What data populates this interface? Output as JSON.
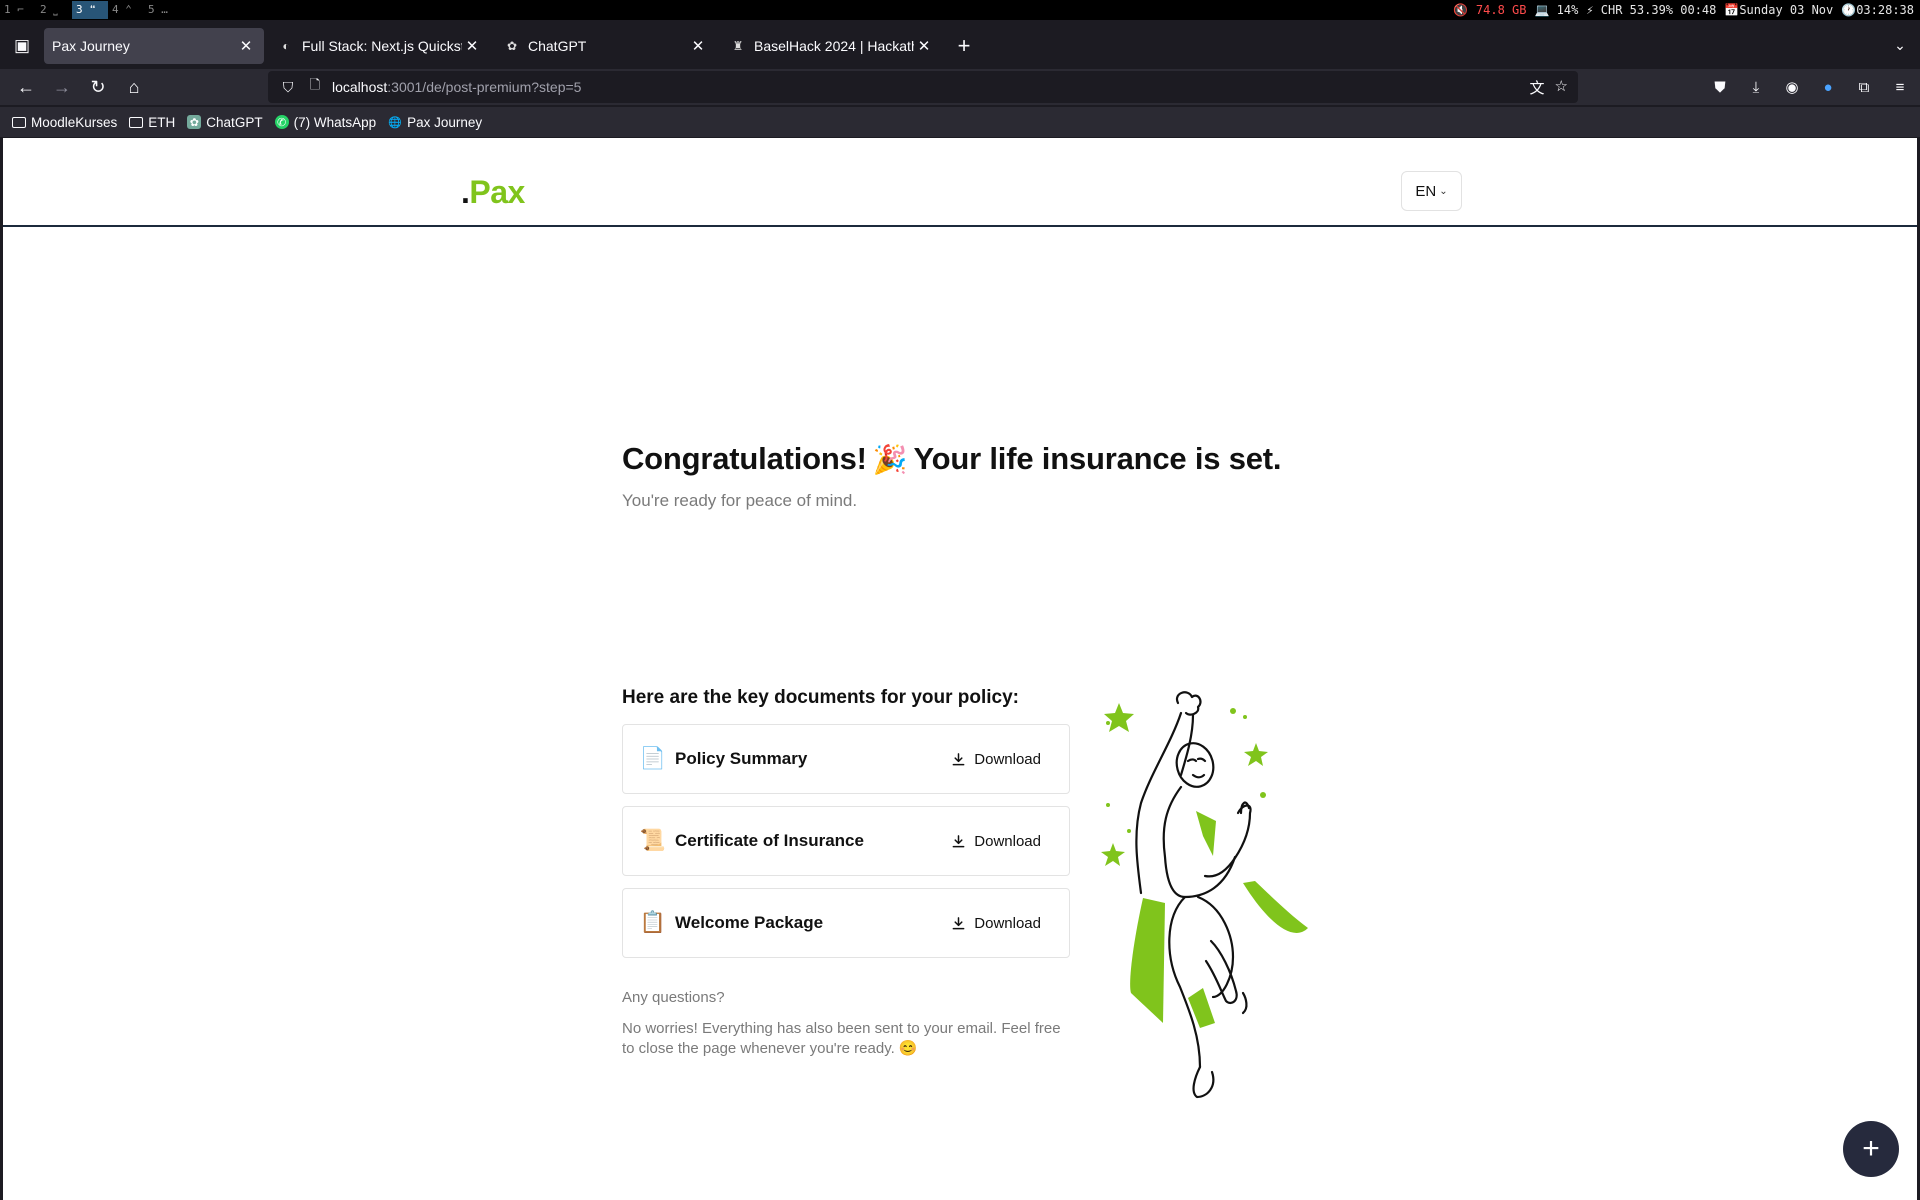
{
  "system": {
    "workspaces": [
      "1 ⌐",
      "2 ⎵",
      "3 ❝",
      "4 ⌃",
      "5 …"
    ],
    "active_workspace": 2,
    "status": [
      "74.8 GB",
      "💻 14%",
      "⚡ CHR 53.39% 00:48",
      "📅Sunday 03 Nov",
      "🕐03:28:38"
    ]
  },
  "browser": {
    "tabs": [
      {
        "title": "Pax Journey",
        "selected": true
      },
      {
        "title": "Full Stack: Next.js Quicksta",
        "selected": false
      },
      {
        "title": "ChatGPT",
        "selected": false
      },
      {
        "title": "BaselHack 2024 | Hackath",
        "selected": false
      }
    ],
    "url_host": "localhost",
    "url_rest": ":3001/de/post-premium?step=5",
    "bookmarks": [
      "MoodleKurses",
      "ETH",
      "ChatGPT",
      "(7) WhatsApp",
      "Pax Journey"
    ]
  },
  "site": {
    "logo_dot": ".",
    "logo_text": "Pax",
    "language": "EN",
    "heading_part1": "Congratulations!",
    "heading_emoji": "🎉",
    "heading_part2": "Your life insurance is set.",
    "subheading": "You're ready for peace of mind.",
    "docs_title": "Here are the key documents for your policy:",
    "documents": [
      {
        "icon": "📄",
        "name": "Policy Summary",
        "action": "Download"
      },
      {
        "icon": "📜",
        "name": "Certificate of Insurance",
        "action": "Download"
      },
      {
        "icon": "📋",
        "name": "Welcome Package",
        "action": "Download"
      }
    ],
    "questions_label": "Any questions?",
    "questions_text": "No worries! Everything has also been sent to your email. Feel free to close the page whenever you're ready. 😊",
    "fab_label": "+"
  },
  "colors": {
    "brand_green": "#80c41c",
    "fab": "#262a3d"
  }
}
